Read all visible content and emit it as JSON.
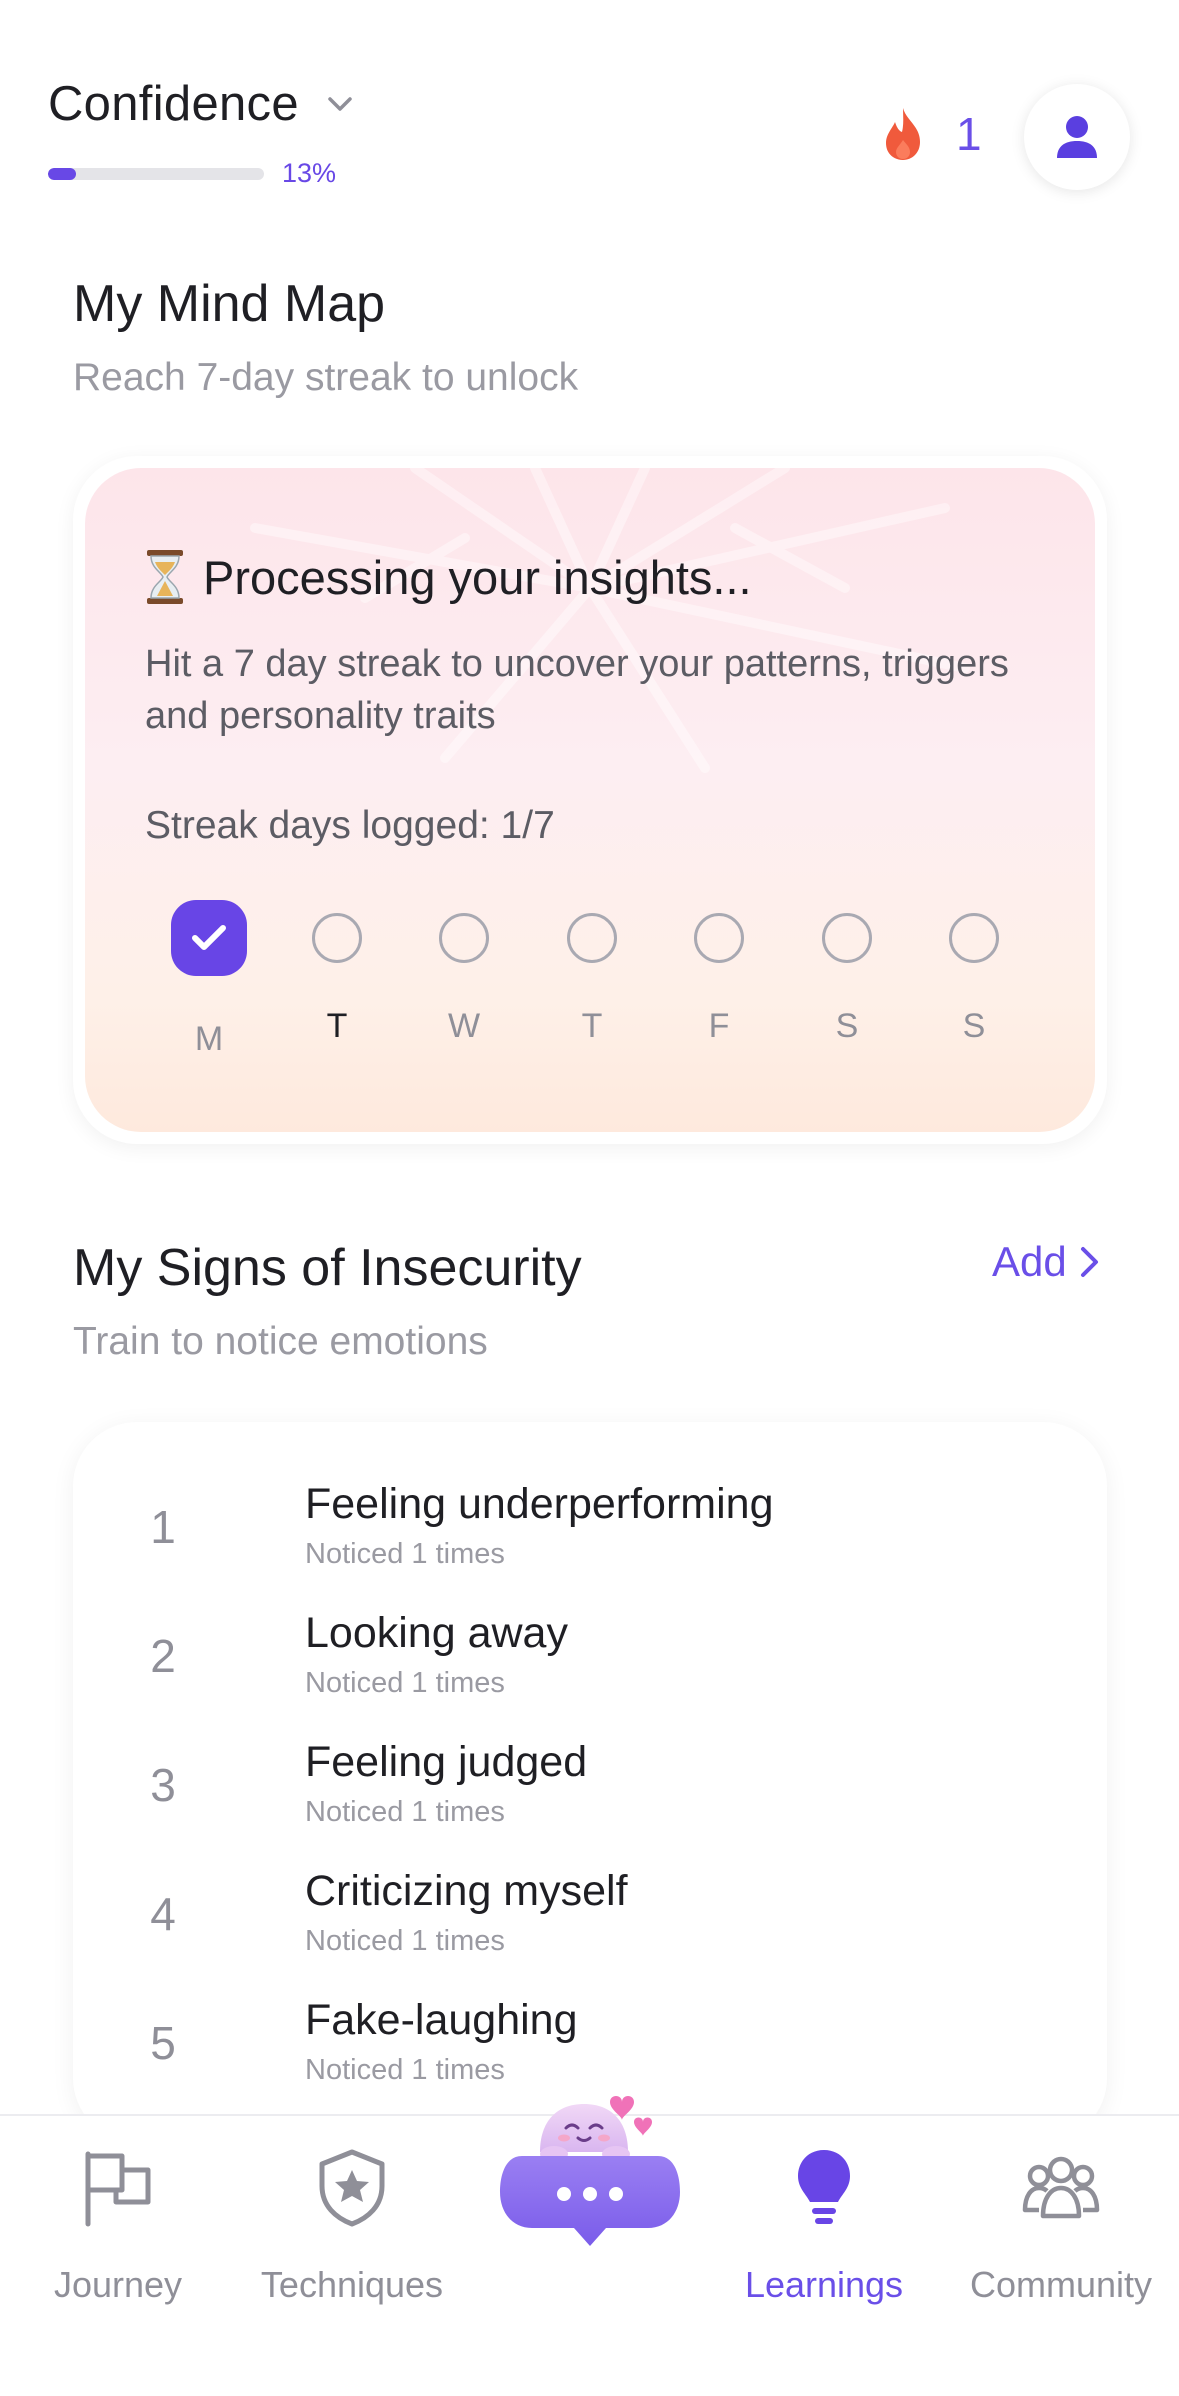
{
  "header": {
    "goal_title": "Confidence",
    "progress_percent": 13,
    "progress_label": "13%",
    "streak_count": "1",
    "flame_color": "#f05a3c",
    "icons": [
      "chevron-down-icon",
      "flame-icon",
      "profile-icon"
    ]
  },
  "mind_map": {
    "title": "My Mind Map",
    "subtitle": "Reach 7-day streak to unlock",
    "card_title": "Processing your insights...",
    "card_description": "Hit a 7 day streak to uncover your patterns, triggers and personality traits",
    "streak_label": "Streak days logged: 1/7",
    "days": [
      {
        "letter": "M",
        "done": true,
        "today": false
      },
      {
        "letter": "T",
        "done": false,
        "today": true
      },
      {
        "letter": "W",
        "done": false,
        "today": false
      },
      {
        "letter": "T",
        "done": false,
        "today": false
      },
      {
        "letter": "F",
        "done": false,
        "today": false
      },
      {
        "letter": "S",
        "done": false,
        "today": false
      },
      {
        "letter": "S",
        "done": false,
        "today": false
      }
    ]
  },
  "signs": {
    "title": "My Signs of Insecurity",
    "subtitle": "Train to notice emotions",
    "add_label": "Add",
    "items": [
      {
        "number": "1",
        "title": "Feeling underperforming",
        "count": "Noticed 1 times"
      },
      {
        "number": "2",
        "title": "Looking away",
        "count": "Noticed 1 times"
      },
      {
        "number": "3",
        "title": "Feeling judged",
        "count": "Noticed 1 times"
      },
      {
        "number": "4",
        "title": "Criticizing myself",
        "count": "Noticed 1 times"
      },
      {
        "number": "5",
        "title": "Fake-laughing",
        "count": "Noticed 1 times"
      }
    ]
  },
  "nav": {
    "items": [
      {
        "label": "Journey",
        "icon": "flag-icon",
        "active": false
      },
      {
        "label": "Techniques",
        "icon": "shield-star-icon",
        "active": false
      },
      {
        "label": "Learnings",
        "icon": "lightbulb-icon",
        "active": true
      },
      {
        "label": "Community",
        "icon": "people-icon",
        "active": false
      }
    ],
    "chat_icon": "chat-mascot-icon"
  },
  "colors": {
    "accent": "#6a4fe8",
    "muted_text": "#9a9aa2",
    "card_gradient_top": "#fde5ea",
    "card_gradient_bottom": "#fee9dd"
  }
}
